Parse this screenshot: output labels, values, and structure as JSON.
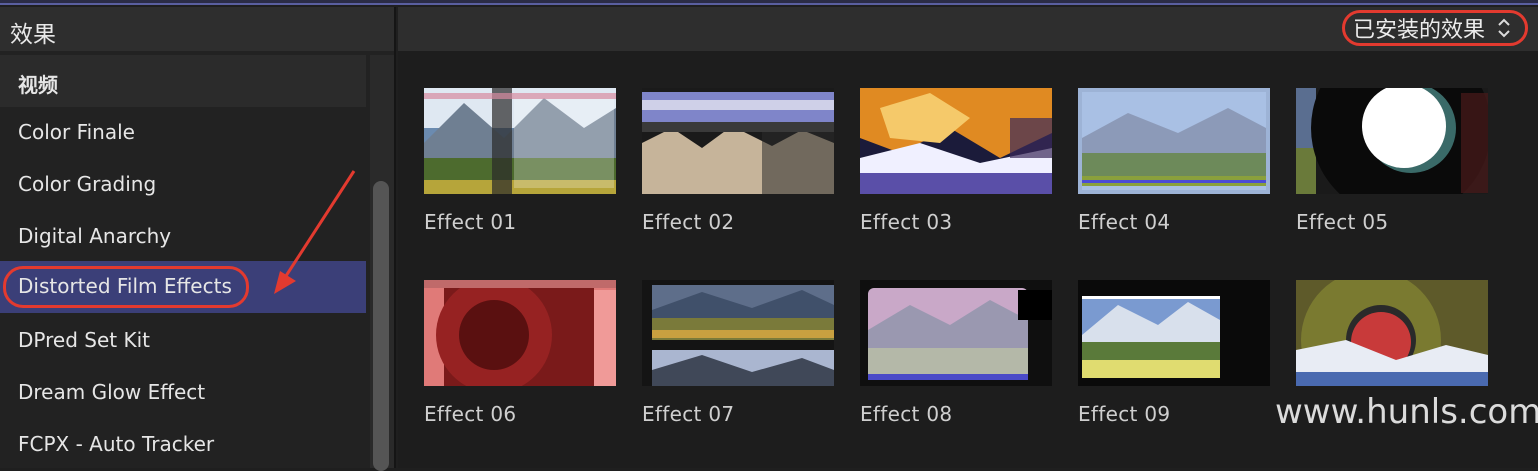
{
  "browser": {
    "title": "效果",
    "filter_label": "已安装的效果"
  },
  "sidebar": {
    "section": "视频",
    "items": [
      {
        "label": "Color Finale"
      },
      {
        "label": "Color Grading"
      },
      {
        "label": "Digital Anarchy"
      },
      {
        "label": "Distorted Film Effects",
        "selected": true
      },
      {
        "label": "DPred Set Kit"
      },
      {
        "label": "Dream Glow Effect"
      },
      {
        "label": "FCPX - Auto Tracker"
      }
    ]
  },
  "effects": [
    {
      "label": "Effect 01"
    },
    {
      "label": "Effect 02"
    },
    {
      "label": "Effect 03"
    },
    {
      "label": "Effect 04"
    },
    {
      "label": "Effect 05"
    },
    {
      "label": "Effect 06"
    },
    {
      "label": "Effect 07"
    },
    {
      "label": "Effect 08"
    },
    {
      "label": "Effect 09"
    }
  ],
  "watermark": "www.hunls.com",
  "colors": {
    "accent_selection": "#3b3f78",
    "annotation_red": "#e33a2f"
  },
  "icons": {
    "filter": "updown-chevron-icon"
  }
}
